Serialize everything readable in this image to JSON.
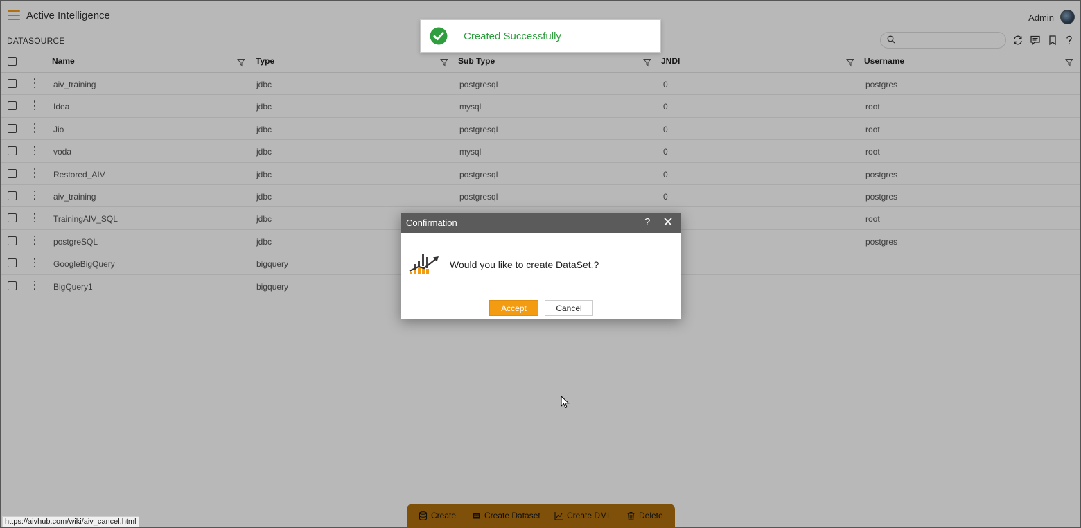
{
  "app": {
    "title": "Active Intelligence",
    "user": "Admin"
  },
  "page": {
    "section_title": "DATASOURCE"
  },
  "search": {
    "value": "",
    "placeholder": ""
  },
  "table": {
    "columns": [
      "Name",
      "Type",
      "Sub Type",
      "JNDI",
      "Username"
    ],
    "rows": [
      {
        "name": "aiv_training",
        "type": "jdbc",
        "subtype": "postgresql",
        "jndi": "0",
        "username": "postgres"
      },
      {
        "name": "Idea",
        "type": "jdbc",
        "subtype": "mysql",
        "jndi": "0",
        "username": "root"
      },
      {
        "name": "Jio",
        "type": "jdbc",
        "subtype": "postgresql",
        "jndi": "0",
        "username": "root"
      },
      {
        "name": "voda",
        "type": "jdbc",
        "subtype": "mysql",
        "jndi": "0",
        "username": "root"
      },
      {
        "name": "Restored_AIV",
        "type": "jdbc",
        "subtype": "postgresql",
        "jndi": "0",
        "username": "postgres"
      },
      {
        "name": "aiv_training",
        "type": "jdbc",
        "subtype": "postgresql",
        "jndi": "0",
        "username": "postgres"
      },
      {
        "name": "TrainingAIV_SQL",
        "type": "jdbc",
        "subtype": "",
        "jndi": "",
        "username": "root"
      },
      {
        "name": "postgreSQL",
        "type": "jdbc",
        "subtype": "",
        "jndi": "",
        "username": "postgres"
      },
      {
        "name": "GoogleBigQuery",
        "type": "bigquery",
        "subtype": "",
        "jndi": "",
        "username": ""
      },
      {
        "name": "BigQuery1",
        "type": "bigquery",
        "subtype": "",
        "jndi": "",
        "username": ""
      }
    ]
  },
  "toast": {
    "message": "Created Successfully",
    "color": "#2e9e3f"
  },
  "dialog": {
    "title": "Confirmation",
    "help": "?",
    "message": "Would you like to create DataSet.?",
    "accept_label": "Accept",
    "cancel_label": "Cancel"
  },
  "toolbar": {
    "create": "Create",
    "create_dataset": "Create Dataset",
    "create_dml": "Create DML",
    "delete": "Delete"
  },
  "status_bar": {
    "url": "https://aivhub.com/wiki/aiv_cancel.html"
  },
  "colors": {
    "accent": "#f39c12",
    "dialog_header": "#5b5b5b"
  }
}
